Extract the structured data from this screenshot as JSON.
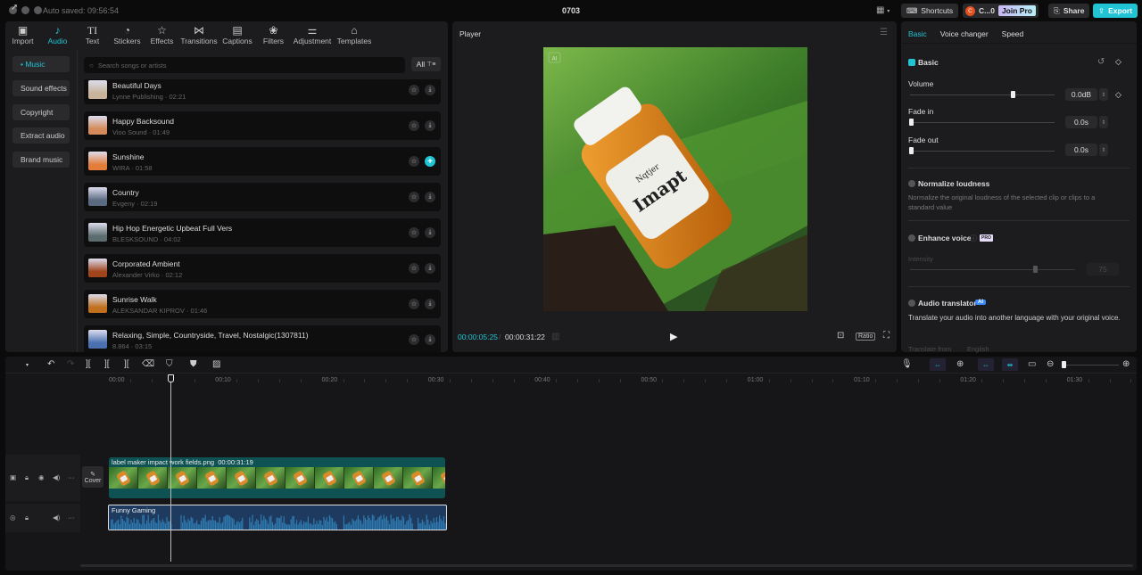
{
  "window": {
    "auto_saved": "Auto saved: 09:56:54",
    "title": "0703",
    "shortcuts_label": "Shortcuts",
    "account_label": "C...0",
    "account_initial": "C",
    "join_pro_label": "Join Pro",
    "share_label": "Share",
    "export_label": "Export"
  },
  "media_tabs": [
    {
      "label": "Import",
      "icon": "import-icon"
    },
    {
      "label": "Audio",
      "icon": "audio-icon",
      "active": true
    },
    {
      "label": "Text",
      "icon": "text-icon"
    },
    {
      "label": "Stickers",
      "icon": "sticker-icon"
    },
    {
      "label": "Effects",
      "icon": "effects-icon"
    },
    {
      "label": "Transitions",
      "icon": "transitions-icon"
    },
    {
      "label": "Captions",
      "icon": "captions-icon"
    },
    {
      "label": "Filters",
      "icon": "filters-icon"
    },
    {
      "label": "Adjustment",
      "icon": "adjustment-icon"
    },
    {
      "label": "Templates",
      "icon": "templates-icon"
    }
  ],
  "audio_sidebar": [
    {
      "label": "• Music",
      "active": true
    },
    {
      "label": "Sound effects"
    },
    {
      "label": "Copyright"
    },
    {
      "label": "Extract audio"
    },
    {
      "label": "Brand music"
    }
  ],
  "search": {
    "placeholder": "Search songs or artists",
    "filter_label": "All"
  },
  "songs": [
    {
      "name": "Beautiful Days",
      "meta": "Lynne Publishing · 02:21"
    },
    {
      "name": "Happy Backsound",
      "meta": "Vioo Sound · 01:49"
    },
    {
      "name": "Sunshine",
      "meta": "WIRA · 01:58",
      "added": true
    },
    {
      "name": "Country",
      "meta": "Evgeny · 02:19"
    },
    {
      "name": "Hip Hop Energetic Upbeat Full Vers",
      "meta": "BLESKSOUND · 04:02"
    },
    {
      "name": "Corporated Ambient",
      "meta": "Alexander Virko · 02:12"
    },
    {
      "name": "Sunrise Walk",
      "meta": "ALEKSANDAR KIPROV · 01:46"
    },
    {
      "name": "Relaxing, Simple, Countryside, Travel, Nostalgic(1307811)",
      "meta": "8.864 · 03:15"
    }
  ],
  "player": {
    "title": "Player",
    "ai_badge": "AI",
    "current_time": "00:00:05:25",
    "total_time": "00:00:31:22",
    "ratio_label": "Ratio",
    "image_text_brand": "Nqtjer",
    "image_text_main": "Imapt"
  },
  "right_panel": {
    "tabs": [
      {
        "label": "Basic",
        "active": true
      },
      {
        "label": "Voice changer"
      },
      {
        "label": "Speed"
      }
    ],
    "basic_label": "Basic",
    "volume_label": "Volume",
    "volume_value": "0.0dB",
    "volume_level": 0.71,
    "fade_in_label": "Fade in",
    "fade_in_value": "0.0s",
    "fade_out_label": "Fade out",
    "fade_out_value": "0.0s",
    "normalize_label": "Normalize loudness",
    "normalize_desc": "Normalize the original loudness of the selected clip or clips to a standard value",
    "enhance_label": "Enhance voice",
    "enhance_badge": "PRO",
    "intensity_label": "Intensity",
    "intensity_value": "75",
    "translator_label": "Audio translator",
    "translator_badge": "AI",
    "translator_desc": "Translate your audio into another language with your original voice.",
    "translate_from_label": "Translate from",
    "translate_from_value": "English"
  },
  "timeline": {
    "ruler": [
      "00:00",
      "00:10",
      "00:20",
      "00:30",
      "00:40",
      "00:50",
      "01:00",
      "01:10",
      "01:20",
      "01:30"
    ],
    "cover_label": "Cover",
    "video_clip_name": "label maker impact work fields.png",
    "video_clip_duration": "00:00:31:19",
    "audio_clip_name": "Funny Gaming"
  },
  "colors": {
    "accent": "#21c4d4",
    "video_clip": "#0e5254",
    "audio_clip": "#1e3a5f"
  }
}
